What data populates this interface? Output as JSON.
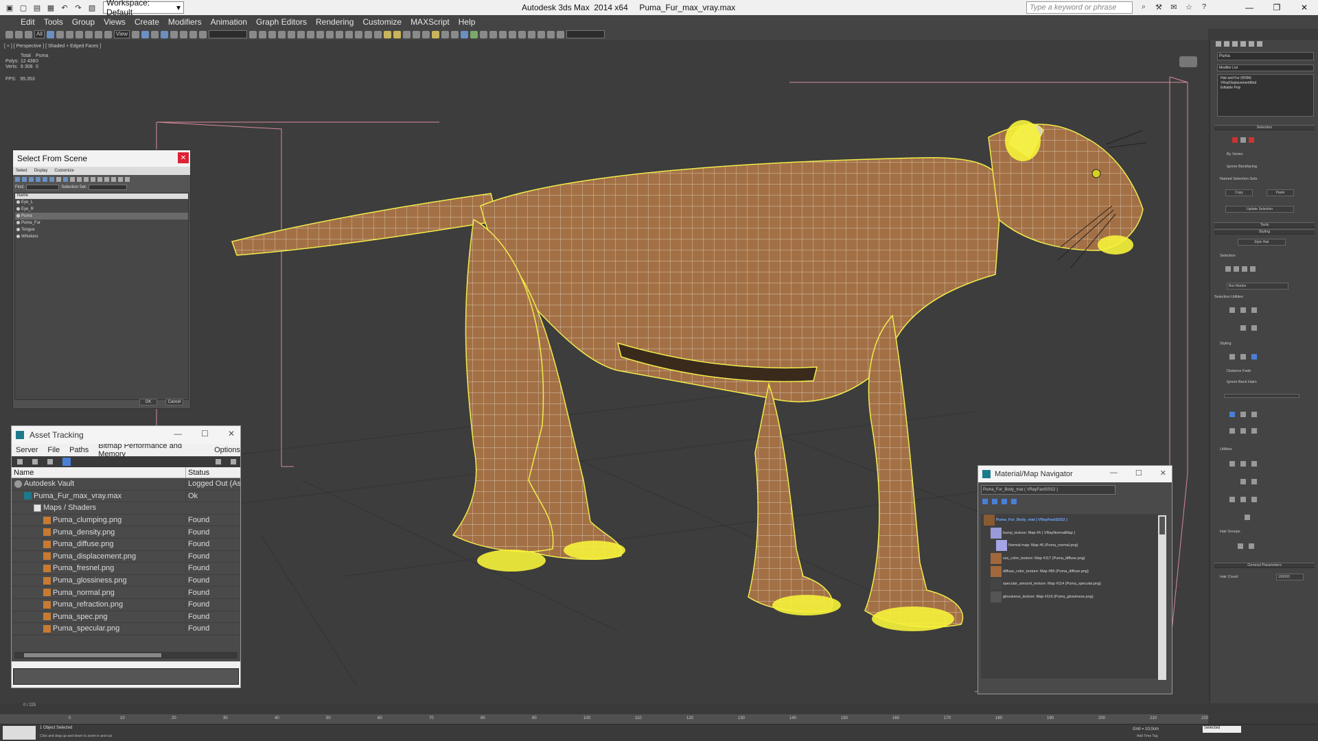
{
  "title_bar": {
    "workspace": "Workspace: Default",
    "app_title": "Autodesk 3ds Max  2014 x64     Puma_Fur_max_vray.max",
    "search_placeholder": "Type a keyword or phrase"
  },
  "menu": [
    "Edit",
    "Tools",
    "Group",
    "Views",
    "Create",
    "Modifiers",
    "Animation",
    "Graph Editors",
    "Rendering",
    "Customize",
    "MAXScript",
    "Help"
  ],
  "toolbar": {
    "selection_filter": "All",
    "view_dropdown": "View"
  },
  "viewport": {
    "label": "[ + ] [ Perspective ] [ Shaded + Edged Faces ]",
    "stats": {
      "col_total": "Total",
      "col_object": "Puma",
      "polys_label": "Polys:",
      "polys_total": "12 438",
      "polys_obj": "0",
      "verts_label": "Verts:",
      "verts_total": "6 308",
      "verts_obj": "0"
    },
    "fps_label": "FPS:",
    "fps_value": "95.353"
  },
  "select_from_scene": {
    "title": "Select From Scene",
    "menu": [
      "Select",
      "Display",
      "Customize"
    ],
    "find_label": "Find:",
    "selection_set_label": "Selection Set:",
    "column_name": "Name",
    "items": [
      {
        "label": "Eye_L",
        "selected": false
      },
      {
        "label": "Eye_R",
        "selected": false
      },
      {
        "label": "Puma",
        "selected": true
      },
      {
        "label": "Puma_Fur",
        "selected": false
      },
      {
        "label": "Tongue",
        "selected": false
      },
      {
        "label": "Whiskers",
        "selected": false
      }
    ],
    "ok": "OK",
    "cancel": "Cancel"
  },
  "asset_tracking": {
    "title": "Asset Tracking",
    "menu": [
      "Server",
      "File",
      "Paths",
      "Bitmap Performance and Memory",
      "Options"
    ],
    "col_name": "Name",
    "col_status": "Status",
    "rows": [
      {
        "name": "Autodesk Vault",
        "status": "Logged Out (Asset Tracking Disabled)",
        "indent": 0,
        "icon": "vault"
      },
      {
        "name": "Puma_Fur_max_vray.max",
        "status": "Ok",
        "indent": 1,
        "icon": "max"
      },
      {
        "name": "Maps / Shaders",
        "status": "",
        "indent": 2,
        "icon": "folder"
      },
      {
        "name": "Puma_clumping.png",
        "status": "Found",
        "indent": 3,
        "icon": "png"
      },
      {
        "name": "Puma_density.png",
        "status": "Found",
        "indent": 3,
        "icon": "png"
      },
      {
        "name": "Puma_diffuse.png",
        "status": "Found",
        "indent": 3,
        "icon": "png"
      },
      {
        "name": "Puma_displacement.png",
        "status": "Found",
        "indent": 3,
        "icon": "png"
      },
      {
        "name": "Puma_fresnel.png",
        "status": "Found",
        "indent": 3,
        "icon": "png"
      },
      {
        "name": "Puma_glossiness.png",
        "status": "Found",
        "indent": 3,
        "icon": "png"
      },
      {
        "name": "Puma_normal.png",
        "status": "Found",
        "indent": 3,
        "icon": "png"
      },
      {
        "name": "Puma_refraction.png",
        "status": "Found",
        "indent": 3,
        "icon": "png"
      },
      {
        "name": "Puma_spec.png",
        "status": "Found",
        "indent": 3,
        "icon": "png"
      },
      {
        "name": "Puma_specular.png",
        "status": "Found",
        "indent": 3,
        "icon": "png"
      }
    ]
  },
  "material_navigator": {
    "title": "Material/Map Navigator",
    "material_name": "Puma_Fur_Body_mat ( VRayFastSSS2 )",
    "nodes": [
      {
        "label": "Puma_Fur_Body_mat ( VRayFastSSS2 )",
        "root": true,
        "swatch": "#8a5a32"
      },
      {
        "label": "bump_texture: Map #6 ( VRayNormalMap )",
        "root": false,
        "swatch": "#9a9ad8"
      },
      {
        "label": "Normal map: Map #6 (Puma_normal.png)",
        "root": false,
        "swatch": "#a4a4e6"
      },
      {
        "label": "sss_color_texture: Map #117 (Puma_diffuse.png)",
        "root": false,
        "swatch": "#a0683c"
      },
      {
        "label": "diffuse_color_texture: Map #86 (Puma_diffuse.png)",
        "root": false,
        "swatch": "#a0683c"
      },
      {
        "label": "specular_amount_texture: Map #114 (Puma_specular.png)",
        "root": false,
        "swatch": "#444444"
      },
      {
        "label": "glossiness_texture: Map #116 (Puma_glossiness.png)",
        "root": false,
        "swatch": "#555555"
      }
    ]
  },
  "command_panel": {
    "object_name": "Puma",
    "modifier_list": "Modifier List",
    "stack": [
      "Hair and Fur (WSM)",
      "VRayDisplacementMod",
      "Editable Poly"
    ],
    "selection_header": "Selection",
    "by_vertex": "By Vertex",
    "ignore_backfacing": "Ignore Backfacing",
    "named_sel_label": "Named Selection Sets",
    "copy": "Copy",
    "paste": "Paste",
    "update_selection": "Update Selection",
    "tools_header": "Tools",
    "styling_header": "Styling",
    "style_hair": "Style Hair",
    "selection2": "Selection",
    "box_marker": "Box Marker",
    "selection_utilities": "Selection Utilities",
    "styling2": "Styling",
    "distance_fade": "Distance Fade",
    "ignore_back_hairs": "Ignore Back Hairs",
    "utilities": "Utilities",
    "hair_groups": "Hair Groups",
    "general_params": "General Parameters",
    "hair_count_label": "Hair Count",
    "hair_count": "100000"
  },
  "timeline": {
    "frame_label": "0 / 225",
    "ticks": [
      "0",
      "10",
      "20",
      "30",
      "40",
      "50",
      "60",
      "70",
      "80",
      "90",
      "100",
      "110",
      "120",
      "130",
      "140",
      "150",
      "160",
      "170",
      "180",
      "190",
      "200",
      "210",
      "220"
    ]
  },
  "status_bar": {
    "selection": "1 Object Selected",
    "hint": "Click and drag up-and-down to zoom in and out",
    "grid": "Grid = 10,0cm",
    "key_filter": "Selected",
    "add_time_tag": "Add Time Tag"
  }
}
